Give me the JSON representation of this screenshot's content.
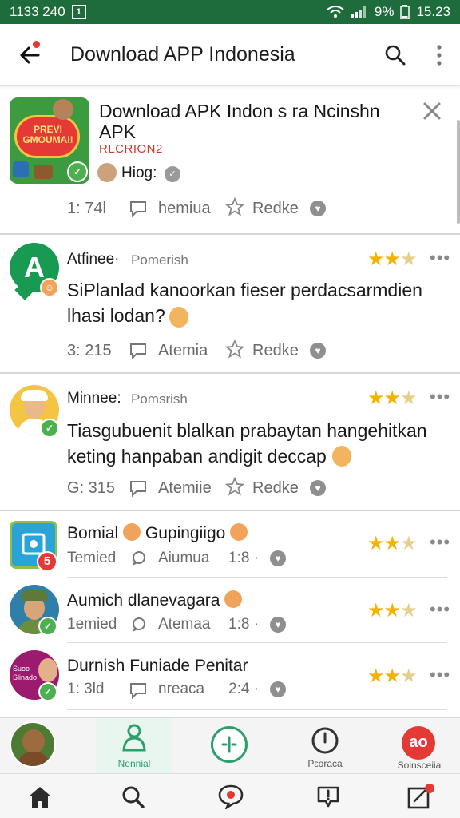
{
  "status_bar": {
    "time_left": "1133 240",
    "sim_glyph": "1",
    "battery": "9%",
    "time_right": "15.23"
  },
  "app_bar": {
    "title": "Download APP Indonesia"
  },
  "featured": {
    "app_icon_text": "PREVI\nGMOUMAI!",
    "title_line1": "Download APK  Indon s ra  Ncinshn",
    "title_line2": "APK",
    "tag": "RLCRION2",
    "author": "Hiog:",
    "count": "1: 74l",
    "comment_label": "hemiua",
    "like_label": "Redke"
  },
  "posts": [
    {
      "avatar_letter": "A",
      "name": "Atfinee·",
      "handle": "Pomerish",
      "text_line1": "SiPlanlad kanoorkan fieser perdacsarmdien",
      "text_line2": "lhasi lodan?",
      "count": "3: 215",
      "comment_label": "Atemia",
      "like_label": "Redke",
      "rating": 3
    },
    {
      "avatar_letter": "",
      "name": "Minnee:",
      "handle": "Pomsrish",
      "text_line1": "Tiasgubuenit blalkan prabaytan hangehitkan",
      "text_line2": "keting hanpaban andigit deccap",
      "count": "G: 315",
      "comment_label": "Atemiie",
      "like_label": "Redke",
      "rating": 3
    }
  ],
  "list_items": [
    {
      "title": "Bomial",
      "title_suffix": "Gupingiigo",
      "sub": "Temied",
      "comment_label": "Aiumua",
      "time": "1:8 ·",
      "badge": "5",
      "rating": 3
    },
    {
      "title": "Aumich dlanevagara",
      "title_suffix": "",
      "sub": "1emied",
      "comment_label": "Atemaa",
      "time": "1:8 ·",
      "badge": "",
      "rating": 3
    },
    {
      "title": "Durnish Funiade Penitar",
      "title_suffix": "",
      "sub": "1: 3ld",
      "comment_label": "nreaca",
      "time": "2:4 ·",
      "badge": "",
      "avatar_text": "Suoo\nSlinado",
      "rating": 3
    }
  ],
  "bottom_tabs": [
    {
      "label": ""
    },
    {
      "label": "Nennial"
    },
    {
      "label": ""
    },
    {
      "label": "Pεoraca"
    },
    {
      "label": "Soinsceiia",
      "badge": "ao"
    }
  ],
  "colors": {
    "status_bar": "#1e6b3c",
    "accent_green": "#2e9e6b",
    "star": "#f3b300",
    "red": "#e53935"
  }
}
